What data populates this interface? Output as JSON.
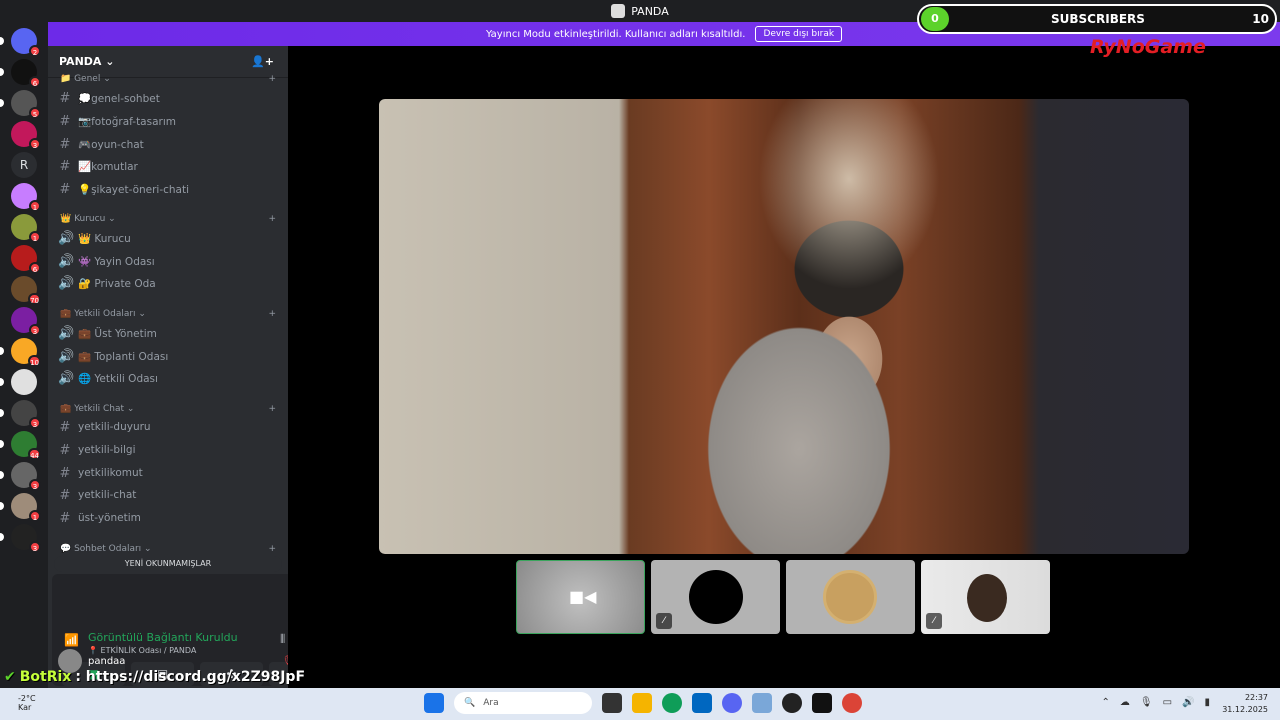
{
  "window": {
    "title": "PANDA"
  },
  "streamer_mode": {
    "message": "Yayıncı Modu etkinleştirildi. Kullanıcı adları kısaltıldı.",
    "button": "Devre dışı bırak"
  },
  "guilds": {
    "items": [
      {
        "color": "#5865f2",
        "badge": "2"
      },
      {
        "color": "#111111",
        "badge": "6"
      },
      {
        "color": "#555555",
        "badge": "5"
      },
      {
        "color": "#c2185b",
        "badge": "3"
      },
      {
        "color": "#2b2d31",
        "letter": "R"
      },
      {
        "color": "#c77dff",
        "badge": "1"
      },
      {
        "color": "#8a9a3b",
        "badge": "1"
      },
      {
        "color": "#b71c1c",
        "badge": "6"
      },
      {
        "color": "#6a4b2b",
        "badge": "70"
      },
      {
        "color": "#7b1fa2",
        "badge": "3"
      },
      {
        "color": "#f9a825",
        "badge": "10"
      },
      {
        "color": "#e0e0e0"
      },
      {
        "color": "#444444",
        "badge": "3"
      },
      {
        "color": "#2e7d32",
        "badge": "44"
      },
      {
        "color": "#666666",
        "badge": "3"
      },
      {
        "color": "#9e8c7a",
        "badge": "1"
      },
      {
        "color": "#222222",
        "badge": "3"
      }
    ]
  },
  "sidebar": {
    "server_name": "PANDA",
    "categories": [
      {
        "name": "Genel"
      },
      {
        "name": "Kurucu"
      },
      {
        "name": "Yetkili Odaları"
      },
      {
        "name": "Yetkili Chat"
      },
      {
        "name": "Sohbet Odaları"
      }
    ],
    "channels": [
      {
        "type": "text",
        "label": "💭genel-sohbet"
      },
      {
        "type": "text",
        "label": "📷fotoğraf-tasarım"
      },
      {
        "type": "text",
        "label": "🎮oyun-chat"
      },
      {
        "type": "text",
        "label": "📈komutlar"
      },
      {
        "type": "text",
        "label": "💡şikayet-öneri-chati"
      },
      {
        "type": "voice",
        "label": "👑 Kurucu"
      },
      {
        "type": "voice",
        "label": "👾 Yayin Odası"
      },
      {
        "type": "voice",
        "label": "🔐 Private Oda"
      },
      {
        "type": "voice",
        "label": "💼 Üst Yönetim"
      },
      {
        "type": "voice",
        "label": "💼 Toplanti Odası"
      },
      {
        "type": "voice",
        "label": "🌐 Yetkili Odası"
      },
      {
        "type": "text",
        "label": "yetkili-duyuru"
      },
      {
        "type": "text",
        "label": "yetkili-bilgi"
      },
      {
        "type": "text",
        "label": "yetkilikomut"
      },
      {
        "type": "text",
        "label": "yetkili-chat"
      },
      {
        "type": "text",
        "label": "üst-yönetim"
      }
    ],
    "unread_label": "YENİ OKUNMAMIŞLAR"
  },
  "voice_panel": {
    "status": "Görüntülü Bağlantı Kuruldu",
    "location": "ETKİNLİK Odası / PANDA"
  },
  "user": {
    "name": "pandaa"
  },
  "overlay": {
    "subs_current": "0",
    "subs_label": "SUBSCRIBERS",
    "subs_goal": "10",
    "brand": "RyNoGame",
    "botrix_name": "BotRix",
    "botrix_message": ": https://discord.gg/x2Z98JpF"
  },
  "taskbar": {
    "temperature": "-2°C",
    "weather": "Kar",
    "search_placeholder": "Ara",
    "time": "22:37",
    "date": "31.12.2025"
  },
  "colors": {
    "accent": "#5865f2",
    "streamer_bar": "#6d2ae8",
    "connected": "#23a55a",
    "subs_fill": "#5cd22b"
  }
}
